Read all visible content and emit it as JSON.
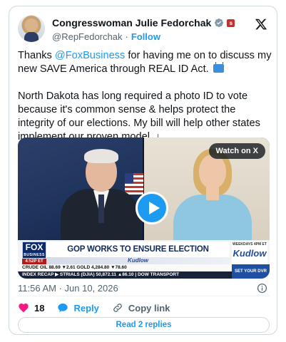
{
  "author": {
    "display_name": "Congresswoman Julie Fedorchak",
    "handle": "@RepFedorchak",
    "follow_label": "Follow",
    "flag_badge_text": "s"
  },
  "tweet": {
    "text_prefix": "Thanks ",
    "mention": "@FoxBusiness",
    "text_after_mention": " for having me on to discuss my new SAVE America through REAL ID Act.",
    "paragraph2": "North Dakota has long required a photo ID to vote because it's common sense & helps protect the integrity of our elections. My bill will help other states implement our proven model. ↓"
  },
  "media": {
    "watch_label": "Watch on X",
    "network_logo": "FOX",
    "network_sub": "BUSINESS",
    "time_chip": "4:52P ET",
    "headline": "GOP WORKS TO ENSURE ELECTION INTEGRITY",
    "show_strip": "Kudlow",
    "show_time": "WEEKDAYS 4PM ET",
    "show_logo": "Kudlow",
    "ticker_row1": "CRUDE OIL   88.69 ▼2.61   GOLD   4,284.80 ▼78.60",
    "ticker_row2": "INDEX RECAP ▶ STRIALS (DJIA) 50,872.11 ▲86.10 | DOW TRANSPORT",
    "dvr_label": "SET YOUR DVR"
  },
  "meta": {
    "timestamp": "11:56 AM · Jun 10, 2026"
  },
  "actions": {
    "like_count": "18",
    "reply_label": "Reply",
    "copy_link_label": "Copy link"
  },
  "read_replies_label": "Read 2 replies",
  "colors": {
    "accent": "#1d9bf0",
    "like": "#f91880",
    "text_secondary": "#536471"
  }
}
